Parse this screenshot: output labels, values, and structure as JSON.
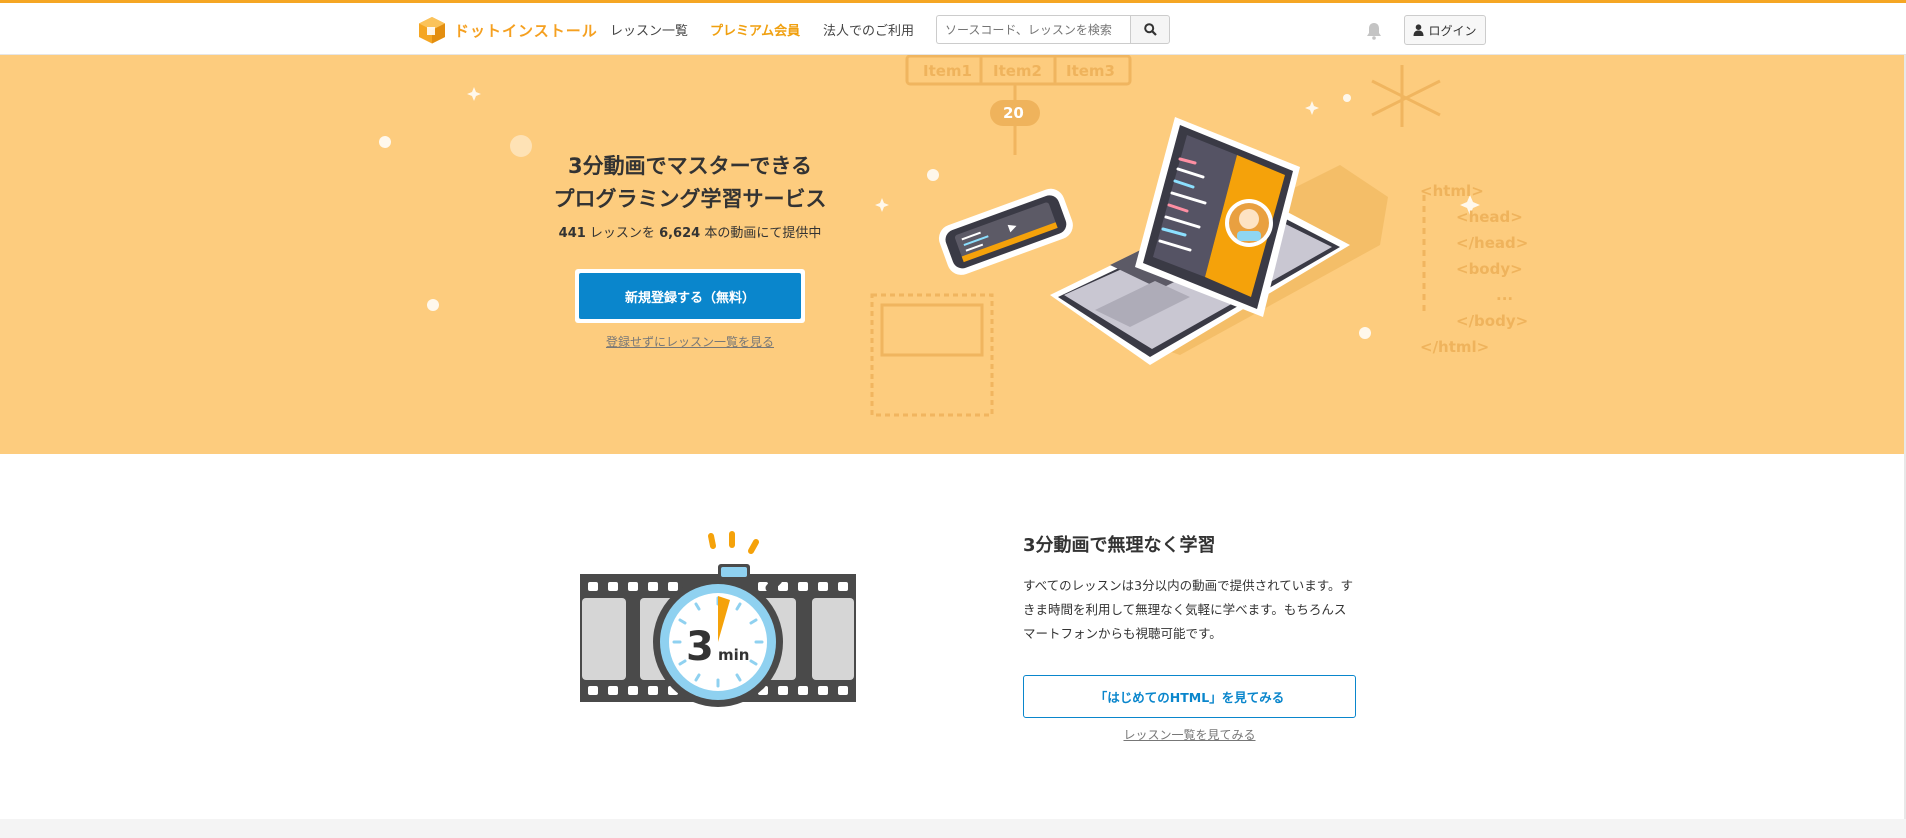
{
  "header": {
    "logo_text": "ドットインストール",
    "nav": [
      {
        "label": "レッスン一覧"
      },
      {
        "label": "プレミアム会員"
      },
      {
        "label": "法人でのご利用"
      }
    ],
    "search_placeholder": "ソースコード、レッスンを検索",
    "login_label": "ログイン"
  },
  "hero": {
    "title_line1": "3分動画でマスターできる",
    "title_line2": "プログラミング学習サービス",
    "lesson_count": "441",
    "lesson_text": " レッスンを ",
    "video_count": "6,624",
    "video_text": " 本の動画にて提供中",
    "signup_label": "新規登録する（無料）",
    "browse_link": "登録せずにレッスン一覧を見る",
    "art_labels": {
      "items": [
        "Item1",
        "Item2",
        "Item3"
      ],
      "number": "20",
      "code": [
        "<html>",
        "<head>",
        "</head>",
        "<body>",
        "...",
        "</body>",
        "</html>"
      ]
    }
  },
  "feature": {
    "title": "3分動画で無理なく学習",
    "description": "すべてのレッスンは3分以内の動画で提供されています。すきま時間を利用して無理なく気軽に学べます。もちろんスマートフォンからも視聴可能です。",
    "button_label": "「はじめてのHTML」を見てみる",
    "link_label": "レッスン一覧を見てみる",
    "timer_number": "3",
    "timer_unit": "min"
  },
  "colors": {
    "accent": "#f5a623",
    "hero_bg": "#fdcc7e",
    "primary_button": "#0a86cc"
  }
}
